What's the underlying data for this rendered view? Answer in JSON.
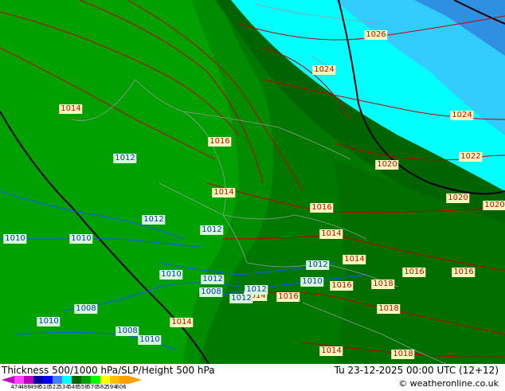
{
  "map": {
    "pressure_labels_red": [
      "1026",
      "1024",
      "1024",
      "1022",
      "1020",
      "1020",
      "1020",
      "1018",
      "1018",
      "1018",
      "1016",
      "1016",
      "1016",
      "1016",
      "1016",
      "1016",
      "1014",
      "1014",
      "1014",
      "1014",
      "1014",
      "1014",
      "1014"
    ],
    "pressure_labels_blue": [
      "1012",
      "1012",
      "1012",
      "1012",
      "1012",
      "1012",
      "1012",
      "1010",
      "1010",
      "1010",
      "1010",
      "1010",
      "1010",
      "1008",
      "1008",
      "1008"
    ],
    "colors": {
      "thickness_bands": [
        "#006400",
        "#007800",
        "#008c00",
        "#00a000",
        "#00c8c8",
        "#00ffff",
        "#00ccff",
        "#33aaff",
        "#2f8fe0"
      ],
      "isobar_red": "#c00000",
      "height_blue": "#1e50ff",
      "border": "#808080",
      "line_black": "#000000"
    }
  },
  "footer": {
    "title": "Thickness 500/1000 hPa/SLP/Height 500 hPa",
    "date": "Tu 23-12-2025 00:00 UTC (12+12)",
    "credit": "© weatheronline.co.uk",
    "scale_values": [
      "474",
      "486",
      "498",
      "510",
      "522",
      "534",
      "546",
      "558",
      "570",
      "582",
      "594",
      "606"
    ],
    "scale_colors": [
      "#ff40ff",
      "#c000c0",
      "#0000a0",
      "#0000ff",
      "#4080ff",
      "#00ffff",
      "#006400",
      "#00a000",
      "#00ff00",
      "#ffff00",
      "#ffc000",
      "#ffa000"
    ]
  }
}
